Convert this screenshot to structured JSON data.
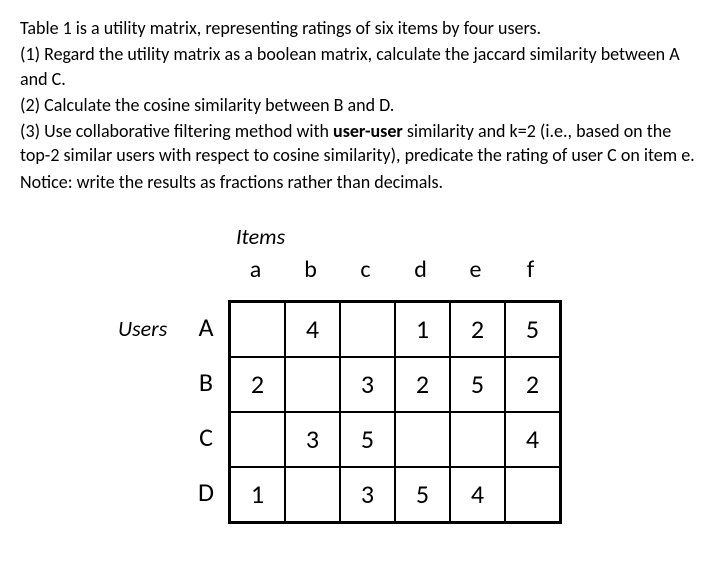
{
  "problem": {
    "intro": "Table 1 is a utility matrix, representing ratings of six items by four users.",
    "q1": "(1) Regard the utility matrix as a boolean matrix, calculate the jaccard similarity between A and C.",
    "q2": "(2) Calculate the cosine similarity between B and D.",
    "q3_pre": "(3) Use collaborative filtering method with ",
    "q3_bold": "user-user",
    "q3_post": " similarity and k=2 (i.e., based on the top-2 similar users with respect to cosine similarity), predicate the rating of user C on item e.",
    "notice": "Notice: write the results as fractions rather than decimals."
  },
  "table": {
    "items_label": "Items",
    "users_label": "Users",
    "columns": [
      "a",
      "b",
      "c",
      "d",
      "e",
      "f"
    ],
    "rows": [
      "A",
      "B",
      "C",
      "D"
    ]
  },
  "chart_data": {
    "type": "table",
    "title": "Utility matrix: ratings of six items by four users",
    "columns": [
      "a",
      "b",
      "c",
      "d",
      "e",
      "f"
    ],
    "rows": [
      "A",
      "B",
      "C",
      "D"
    ],
    "values": [
      [
        null,
        4,
        null,
        1,
        2,
        5
      ],
      [
        2,
        null,
        3,
        2,
        5,
        2
      ],
      [
        null,
        3,
        5,
        null,
        null,
        4
      ],
      [
        1,
        null,
        3,
        5,
        4,
        null
      ]
    ]
  }
}
